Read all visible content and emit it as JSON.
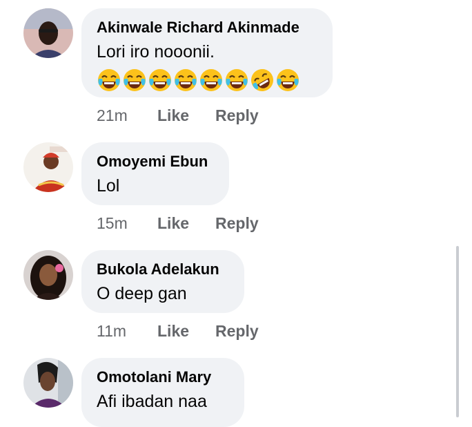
{
  "comments": [
    {
      "author": "Akinwale Richard Akinmade",
      "text": "Lori iro nooonii.",
      "emojis": [
        "face-with-tears-of-joy",
        "face-with-tears-of-joy",
        "face-with-tears-of-joy",
        "face-with-tears-of-joy",
        "face-with-tears-of-joy",
        "face-with-tears-of-joy",
        "rolling-on-the-floor-laughing",
        "face-with-tears-of-joy"
      ],
      "time": "21m",
      "like": "Like",
      "reply": "Reply"
    },
    {
      "author": "Omoyemi Ebun",
      "text": "Lol",
      "time": "15m",
      "like": "Like",
      "reply": "Reply"
    },
    {
      "author": "Bukola Adelakun",
      "text": "O deep gan",
      "time": "11m",
      "like": "Like",
      "reply": "Reply"
    },
    {
      "author": "Omotolani Mary",
      "text": "Afi ibadan naa"
    }
  ],
  "colors": {
    "bubble": "#f0f2f5",
    "name": "#050505",
    "meta": "#65676b",
    "emoji_face": "#fcc21b",
    "tears": "#40c0e7"
  }
}
